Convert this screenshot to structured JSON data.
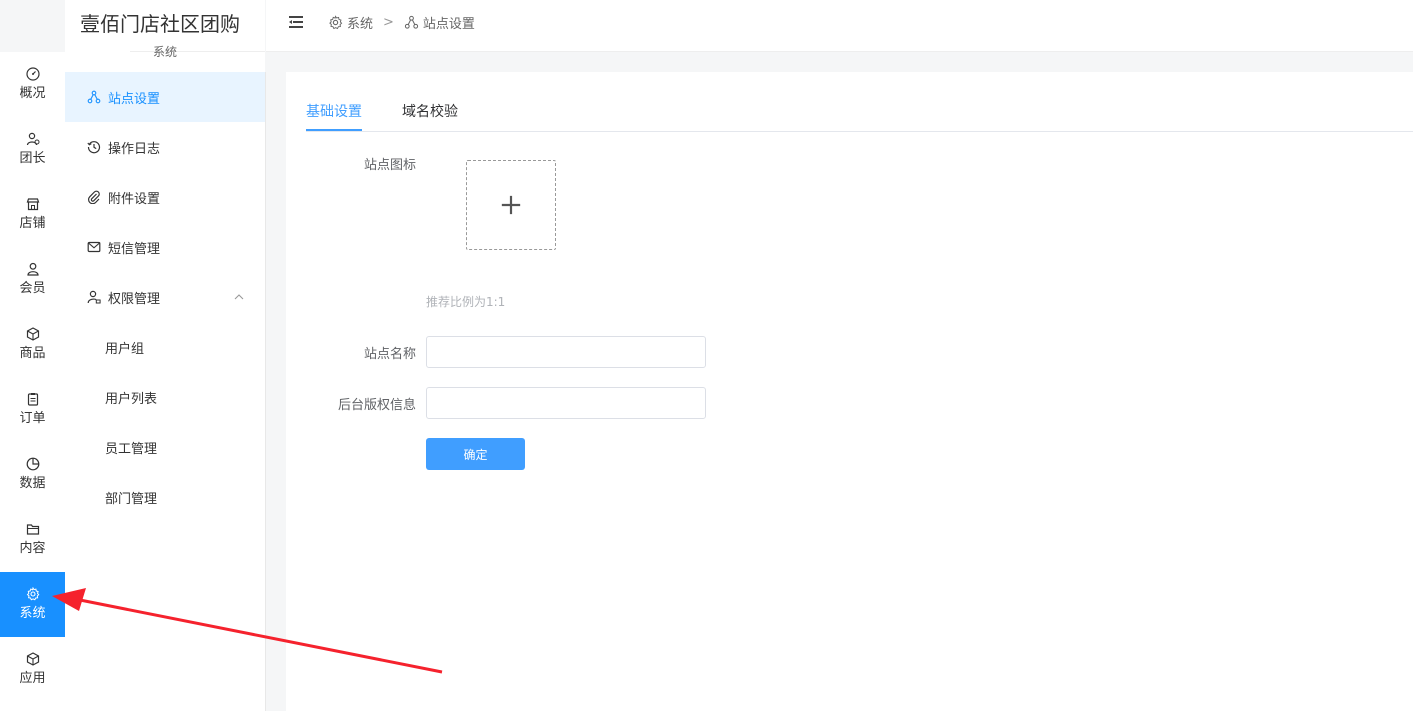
{
  "brand": {
    "title": "壹佰门店社区团购",
    "subtitle": "系统"
  },
  "rail": {
    "items": [
      {
        "label": "概况",
        "icon": "dashboard-icon"
      },
      {
        "label": "团长",
        "icon": "user-group-icon"
      },
      {
        "label": "店铺",
        "icon": "store-icon"
      },
      {
        "label": "会员",
        "icon": "user-icon"
      },
      {
        "label": "商品",
        "icon": "cube-icon"
      },
      {
        "label": "订单",
        "icon": "clipboard-icon"
      },
      {
        "label": "数据",
        "icon": "pie-chart-icon"
      },
      {
        "label": "内容",
        "icon": "folder-icon"
      },
      {
        "label": "系统",
        "icon": "gear-icon",
        "active": true
      },
      {
        "label": "应用",
        "icon": "box-icon"
      }
    ]
  },
  "subnav": {
    "items": [
      {
        "label": "站点设置",
        "icon": "sitemap-icon",
        "active": true
      },
      {
        "label": "操作日志",
        "icon": "history-icon"
      },
      {
        "label": "附件设置",
        "icon": "paperclip-icon"
      },
      {
        "label": "短信管理",
        "icon": "mail-icon"
      },
      {
        "label": "权限管理",
        "icon": "user-lock-icon",
        "expanded": true
      }
    ],
    "children": [
      "用户组",
      "用户列表",
      "员工管理",
      "部门管理"
    ]
  },
  "header": {
    "breadcrumb": [
      {
        "label": "系统",
        "icon": "gear-icon"
      },
      {
        "label": "站点设置",
        "icon": "sitemap-icon"
      }
    ],
    "separator": ">"
  },
  "tabs": [
    {
      "label": "基础设置",
      "active": true
    },
    {
      "label": "域名校验"
    }
  ],
  "form": {
    "icon_label": "站点图标",
    "upload_plus": "+",
    "icon_hint": "推荐比例为1:1",
    "name_label": "站点名称",
    "name_value": "",
    "copyright_label": "后台版权信息",
    "copyright_value": "",
    "submit_label": "确定"
  },
  "colors": {
    "primary": "#1890ff",
    "tab_active": "#409eff",
    "annotation_arrow": "#f5222d"
  }
}
